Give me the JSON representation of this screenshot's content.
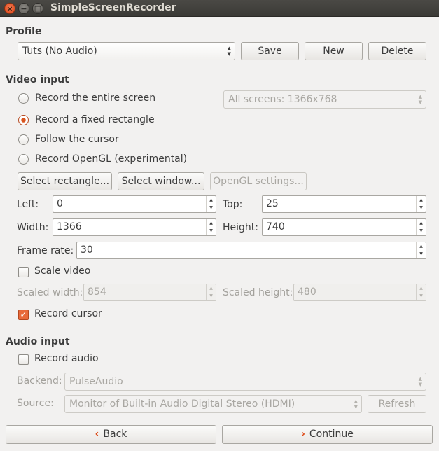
{
  "window": {
    "title": "SimpleScreenRecorder"
  },
  "profile": {
    "section_title": "Profile",
    "selected": "Tuts (No Audio)",
    "save_label": "Save",
    "new_label": "New",
    "delete_label": "Delete"
  },
  "video_input": {
    "section_title": "Video input",
    "options": [
      {
        "label": "Record the entire screen",
        "checked": false
      },
      {
        "label": "Record a fixed rectangle",
        "checked": true
      },
      {
        "label": "Follow the cursor",
        "checked": false
      },
      {
        "label": "Record OpenGL (experimental)",
        "checked": false
      }
    ],
    "screens_select": "All screens: 1366x768",
    "select_rectangle_label": "Select rectangle...",
    "select_window_label": "Select window...",
    "opengl_settings_label": "OpenGL settings...",
    "left_label": "Left:",
    "left_value": "0",
    "top_label": "Top:",
    "top_value": "25",
    "width_label": "Width:",
    "width_value": "1366",
    "height_label": "Height:",
    "height_value": "740",
    "frame_rate_label": "Frame rate:",
    "frame_rate_value": "30",
    "scale_video_label": "Scale video",
    "scale_video_checked": false,
    "scaled_width_label": "Scaled width:",
    "scaled_width_value": "854",
    "scaled_height_label": "Scaled height:",
    "scaled_height_value": "480",
    "record_cursor_label": "Record cursor",
    "record_cursor_checked": true
  },
  "audio_input": {
    "section_title": "Audio input",
    "record_audio_label": "Record audio",
    "record_audio_checked": false,
    "backend_label": "Backend:",
    "backend_value": "PulseAudio",
    "source_label": "Source:",
    "source_value": "Monitor of Built-in Audio Digital Stereo (HDMI)",
    "refresh_label": "Refresh"
  },
  "navigation": {
    "back_label": "Back",
    "continue_label": "Continue"
  },
  "colors": {
    "accent": "#dd4814",
    "titlebar": "#3c3b37",
    "background": "#f2f1f0"
  }
}
